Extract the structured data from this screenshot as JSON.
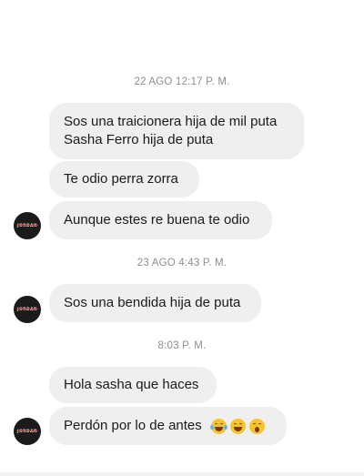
{
  "conversation": {
    "groups": [
      {
        "timestamp": "22 AGO 12:17 P. M.",
        "messages": [
          {
            "lines": [
              "Sos una traicionera hija de mil puta",
              "Sasha Ferro hija de puta"
            ]
          },
          {
            "lines": [
              "Te odio perra zorra"
            ]
          },
          {
            "lines": [
              "Aunque estes re buena te odio"
            ]
          }
        ]
      },
      {
        "timestamp": "23 AGO 4:43 P. M.",
        "messages": [
          {
            "lines": [
              "Sos una bendida hija de puta"
            ]
          }
        ]
      },
      {
        "timestamp": "8:03 P. M.",
        "messages": [
          {
            "lines": [
              "Hola sasha que haces"
            ]
          },
          {
            "lines": [
              "Perdón por lo de antes"
            ],
            "emojis": [
              "face-with-tears-of-joy-icon",
              "grinning-face-icon",
              "face-with-open-mouth-icon"
            ]
          }
        ]
      }
    ],
    "avatar_logo_text": "JORDAN"
  },
  "colors": {
    "bubble_bg": "#efefef",
    "timestamp_text": "#8e8e93",
    "message_text": "#1a1a1a",
    "avatar_bg": "#1b1b1b",
    "avatar_accent": "#b7332b"
  }
}
